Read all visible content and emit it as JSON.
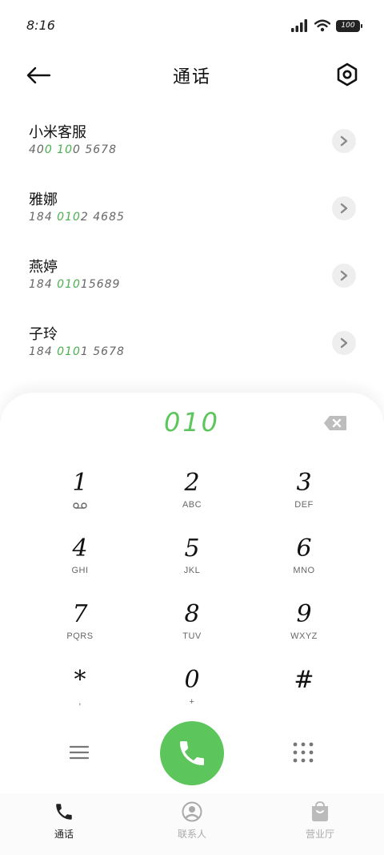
{
  "status_bar": {
    "time": "8:16",
    "battery": "100"
  },
  "header": {
    "title": "通话"
  },
  "results": [
    {
      "name": "小米客服",
      "number_pre": "40",
      "number_match": "0 10",
      "number_post": "0 5678"
    },
    {
      "name": "雅娜",
      "number_pre": "184 ",
      "number_match": "010",
      "number_post": "2 4685"
    },
    {
      "name": "燕婷",
      "number_pre": "184 ",
      "number_match": "010",
      "number_post": "15689"
    },
    {
      "name": "子玲",
      "number_pre": "184 ",
      "number_match": "010",
      "number_post": "1 5678"
    }
  ],
  "dialpad": {
    "dialed": "010",
    "keys": [
      {
        "digit": "1",
        "letters": ""
      },
      {
        "digit": "2",
        "letters": "ABC"
      },
      {
        "digit": "3",
        "letters": "DEF"
      },
      {
        "digit": "4",
        "letters": "GHI"
      },
      {
        "digit": "5",
        "letters": "JKL"
      },
      {
        "digit": "6",
        "letters": "MNO"
      },
      {
        "digit": "7",
        "letters": "PQRS"
      },
      {
        "digit": "8",
        "letters": "TUV"
      },
      {
        "digit": "9",
        "letters": "WXYZ"
      },
      {
        "digit": "*",
        "letters": ","
      },
      {
        "digit": "0",
        "letters": "+"
      },
      {
        "digit": "#",
        "letters": ""
      }
    ]
  },
  "nav": {
    "calls": "通话",
    "contacts": "联系人",
    "service": "营业厅"
  },
  "colors": {
    "accent": "#5cc55c",
    "match": "#4caf50"
  }
}
